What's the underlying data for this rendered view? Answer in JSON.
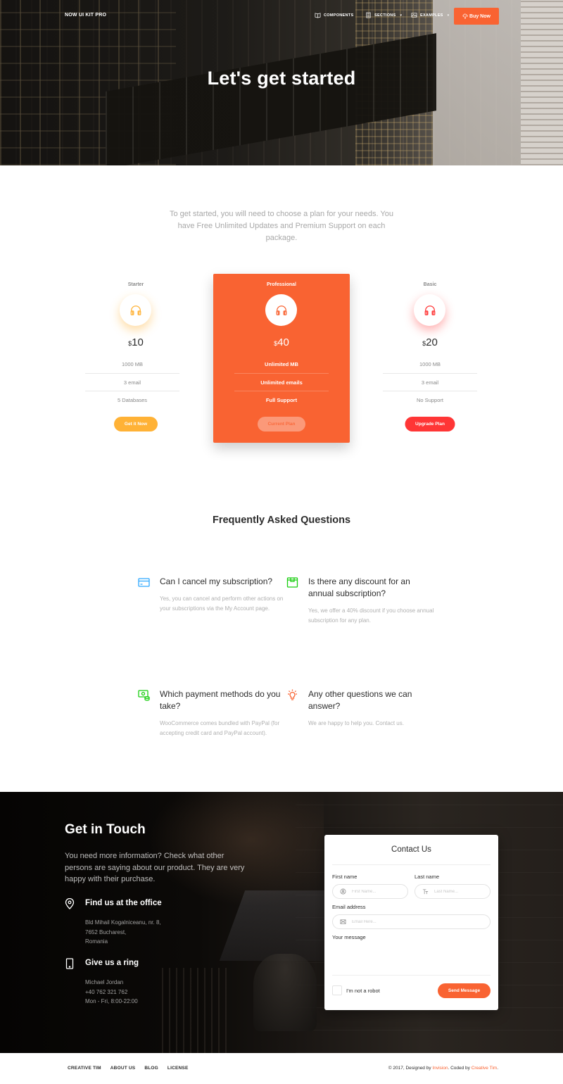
{
  "colors": {
    "primary": "#f96332",
    "warning": "#ffb236",
    "danger": "#ff3636",
    "info": "#2ca8ff",
    "success": "#18ce0f"
  },
  "navbar": {
    "brand": "NOW UI KIT PRO",
    "items": [
      {
        "label": "COMPONENTS",
        "icon": "book-icon",
        "has_dropdown": false
      },
      {
        "label": "SECTIONS",
        "icon": "layout-icon",
        "has_dropdown": true
      },
      {
        "label": "EXAMPLES",
        "icon": "image-icon",
        "has_dropdown": true
      }
    ],
    "cta": {
      "label": "Buy Now",
      "icon": "cloud-download-icon"
    }
  },
  "hero": {
    "title": "Let's get started"
  },
  "pricing": {
    "intro": "To get started, you will need to choose a plan for your needs. You have Free Unlimited Updates and Premium Support on each package.",
    "plans": [
      {
        "name": "Starter",
        "icon": "headphones-icon",
        "currency": "$",
        "price": "10",
        "features": [
          "1000 MB",
          "3 email",
          "5 Databases"
        ],
        "button": "Get it Now",
        "color": "#ffb236"
      },
      {
        "name": "Professional",
        "icon": "headphones-icon",
        "currency": "$",
        "price": "40",
        "features": [
          "Unlimited MB",
          "Unlimited emails",
          "Full Support"
        ],
        "button": "Current Plan",
        "highlighted": true,
        "color": "#f96332"
      },
      {
        "name": "Basic",
        "icon": "headphones-icon",
        "currency": "$",
        "price": "20",
        "features": [
          "1000 MB",
          "3 email",
          "No Support"
        ],
        "button": "Upgrade Plan",
        "color": "#ff3636"
      }
    ]
  },
  "faq": {
    "title": "Frequently Asked Questions",
    "items": [
      {
        "icon": "credit-card-icon",
        "question": "Can I cancel my subscription?",
        "answer": "Yes, you can cancel and perform other actions on your subscriptions via the My Account page."
      },
      {
        "icon": "box-icon",
        "question": "Is there any discount for an annual subscription?",
        "answer": "Yes, we offer a 40% discount if you choose annual subscription for any plan."
      },
      {
        "icon": "money-icon",
        "question": "Which payment methods do you take?",
        "answer": "WooCommerce comes bundled with PayPal (for accepting credit card and PayPal account)."
      },
      {
        "icon": "bulb-icon",
        "question": "Any other questions we can answer?",
        "answer": "We are happy to help you. Contact us."
      }
    ]
  },
  "contact": {
    "title": "Get in Touch",
    "description": "You need more information? Check what other persons are saying about our product. They are very happy with their purchase.",
    "office": {
      "title": "Find us at the office",
      "lines": [
        "Bld Mihail Kogalniceanu, nr. 8,",
        "7652 Bucharest,",
        "Romania"
      ]
    },
    "phone": {
      "title": "Give us a ring",
      "lines": [
        "Michael Jordan",
        "+40 762 321 762",
        "Mon - Fri, 8:00-22:00"
      ]
    },
    "form": {
      "title": "Contact Us",
      "first_name_label": "First name",
      "first_name_placeholder": "First Name...",
      "last_name_label": "Last name",
      "last_name_placeholder": "Last Name...",
      "email_label": "Email address",
      "email_placeholder": "Email Here...",
      "message_label": "Your message",
      "message_value": "",
      "captcha_label": "I'm not a robot",
      "submit": "Send Message"
    }
  },
  "footer": {
    "links": [
      "CREATIVE TIM",
      "ABOUT US",
      "BLOG",
      "LICENSE"
    ],
    "copyright_prefix": "© 2017, Designed by ",
    "designer": "Invision",
    "copyright_mid": ". Coded by ",
    "coder": "Creative Tim",
    "copyright_suffix": "."
  }
}
